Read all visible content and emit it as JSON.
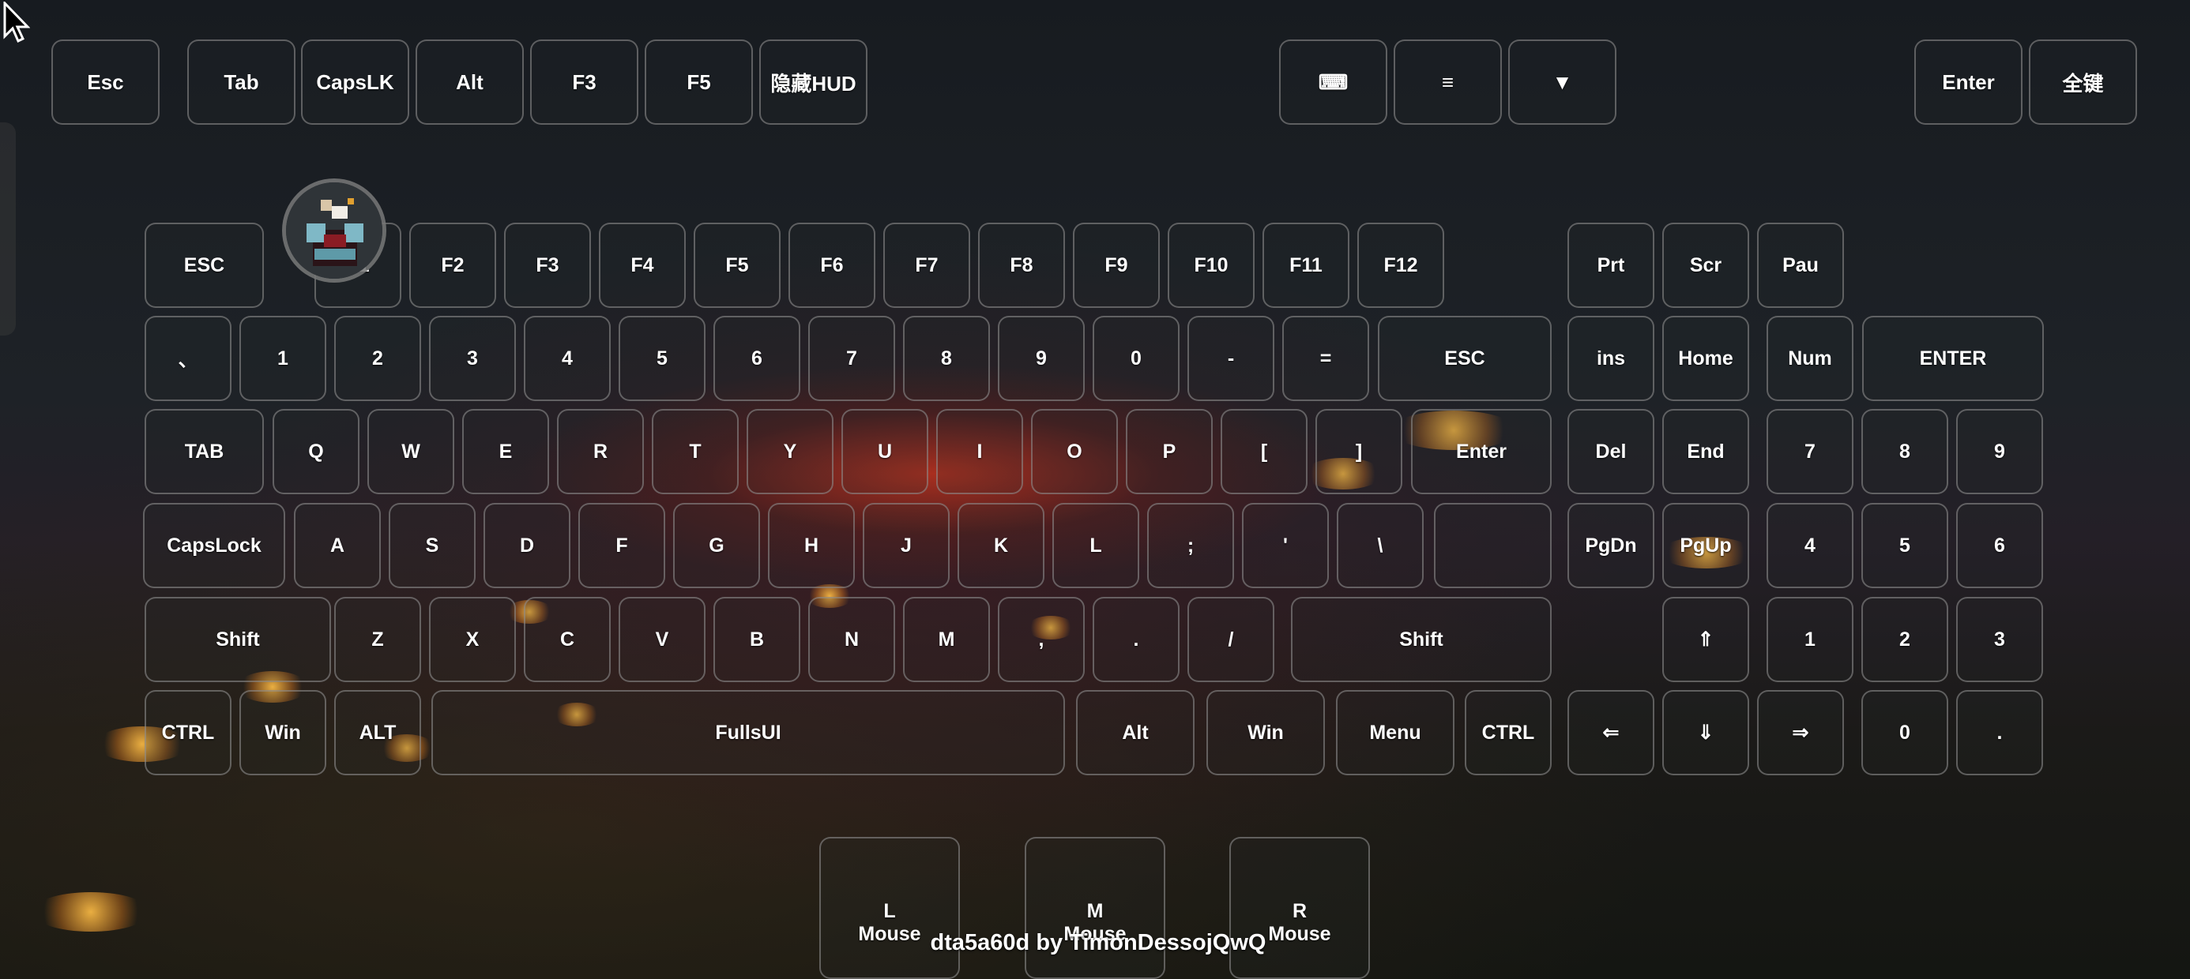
{
  "top_bar": {
    "esc": "Esc",
    "tab": "Tab",
    "capslk": "CapsLK",
    "alt": "Alt",
    "f3": "F3",
    "f5": "F5",
    "hide_hud": "隐藏HUD",
    "keyboard": "⌨",
    "menu": "≡",
    "collapse": "▼",
    "enter": "Enter",
    "all_keys": "全键"
  },
  "keyboard": {
    "fn_row": [
      "ESC",
      "F1",
      "F2",
      "F3",
      "F4",
      "F5",
      "F6",
      "F7",
      "F8",
      "F9",
      "F10",
      "F11",
      "F12",
      "Prt",
      "Scr",
      "Pau"
    ],
    "num_row": [
      "、",
      "1",
      "2",
      "3",
      "4",
      "5",
      "6",
      "7",
      "8",
      "9",
      "0",
      "-",
      "=",
      "ESC",
      "ins",
      "Home",
      "Num",
      "ENTER"
    ],
    "q_row": [
      "TAB",
      "Q",
      "W",
      "E",
      "R",
      "T",
      "Y",
      "U",
      "I",
      "O",
      "P",
      "[",
      "]",
      "Enter",
      "Del",
      "End",
      "7",
      "8",
      "9"
    ],
    "a_row": [
      "CapsLock",
      "A",
      "S",
      "D",
      "F",
      "G",
      "H",
      "J",
      "K",
      "L",
      ";",
      "'",
      "\\",
      "",
      "PgDn",
      "PgUp",
      "4",
      "5",
      "6"
    ],
    "z_row": [
      "Shift",
      "Z",
      "X",
      "C",
      "V",
      "B",
      "N",
      "M",
      ",",
      ".",
      "/",
      "Shift",
      "⇑",
      "1",
      "2",
      "3"
    ],
    "ctrl_row": [
      "CTRL",
      "Win",
      "ALT",
      "FullsUI",
      "Alt",
      "Win",
      "Menu",
      "CTRL",
      "⇐",
      "⇓",
      "⇒",
      "0",
      "."
    ]
  },
  "mouse": {
    "left": "L\nMouse",
    "middle": "M\nMouse",
    "right": "R\nMouse"
  },
  "credit": "dta5a60d by TimonDessojQwQ",
  "colors": {
    "key_border": "#969696",
    "text": "#ffffff",
    "sunset": "#be321e"
  },
  "icons": {
    "cursor": "arrow-cursor-icon",
    "avatar": "minecraft-avatar-icon"
  }
}
